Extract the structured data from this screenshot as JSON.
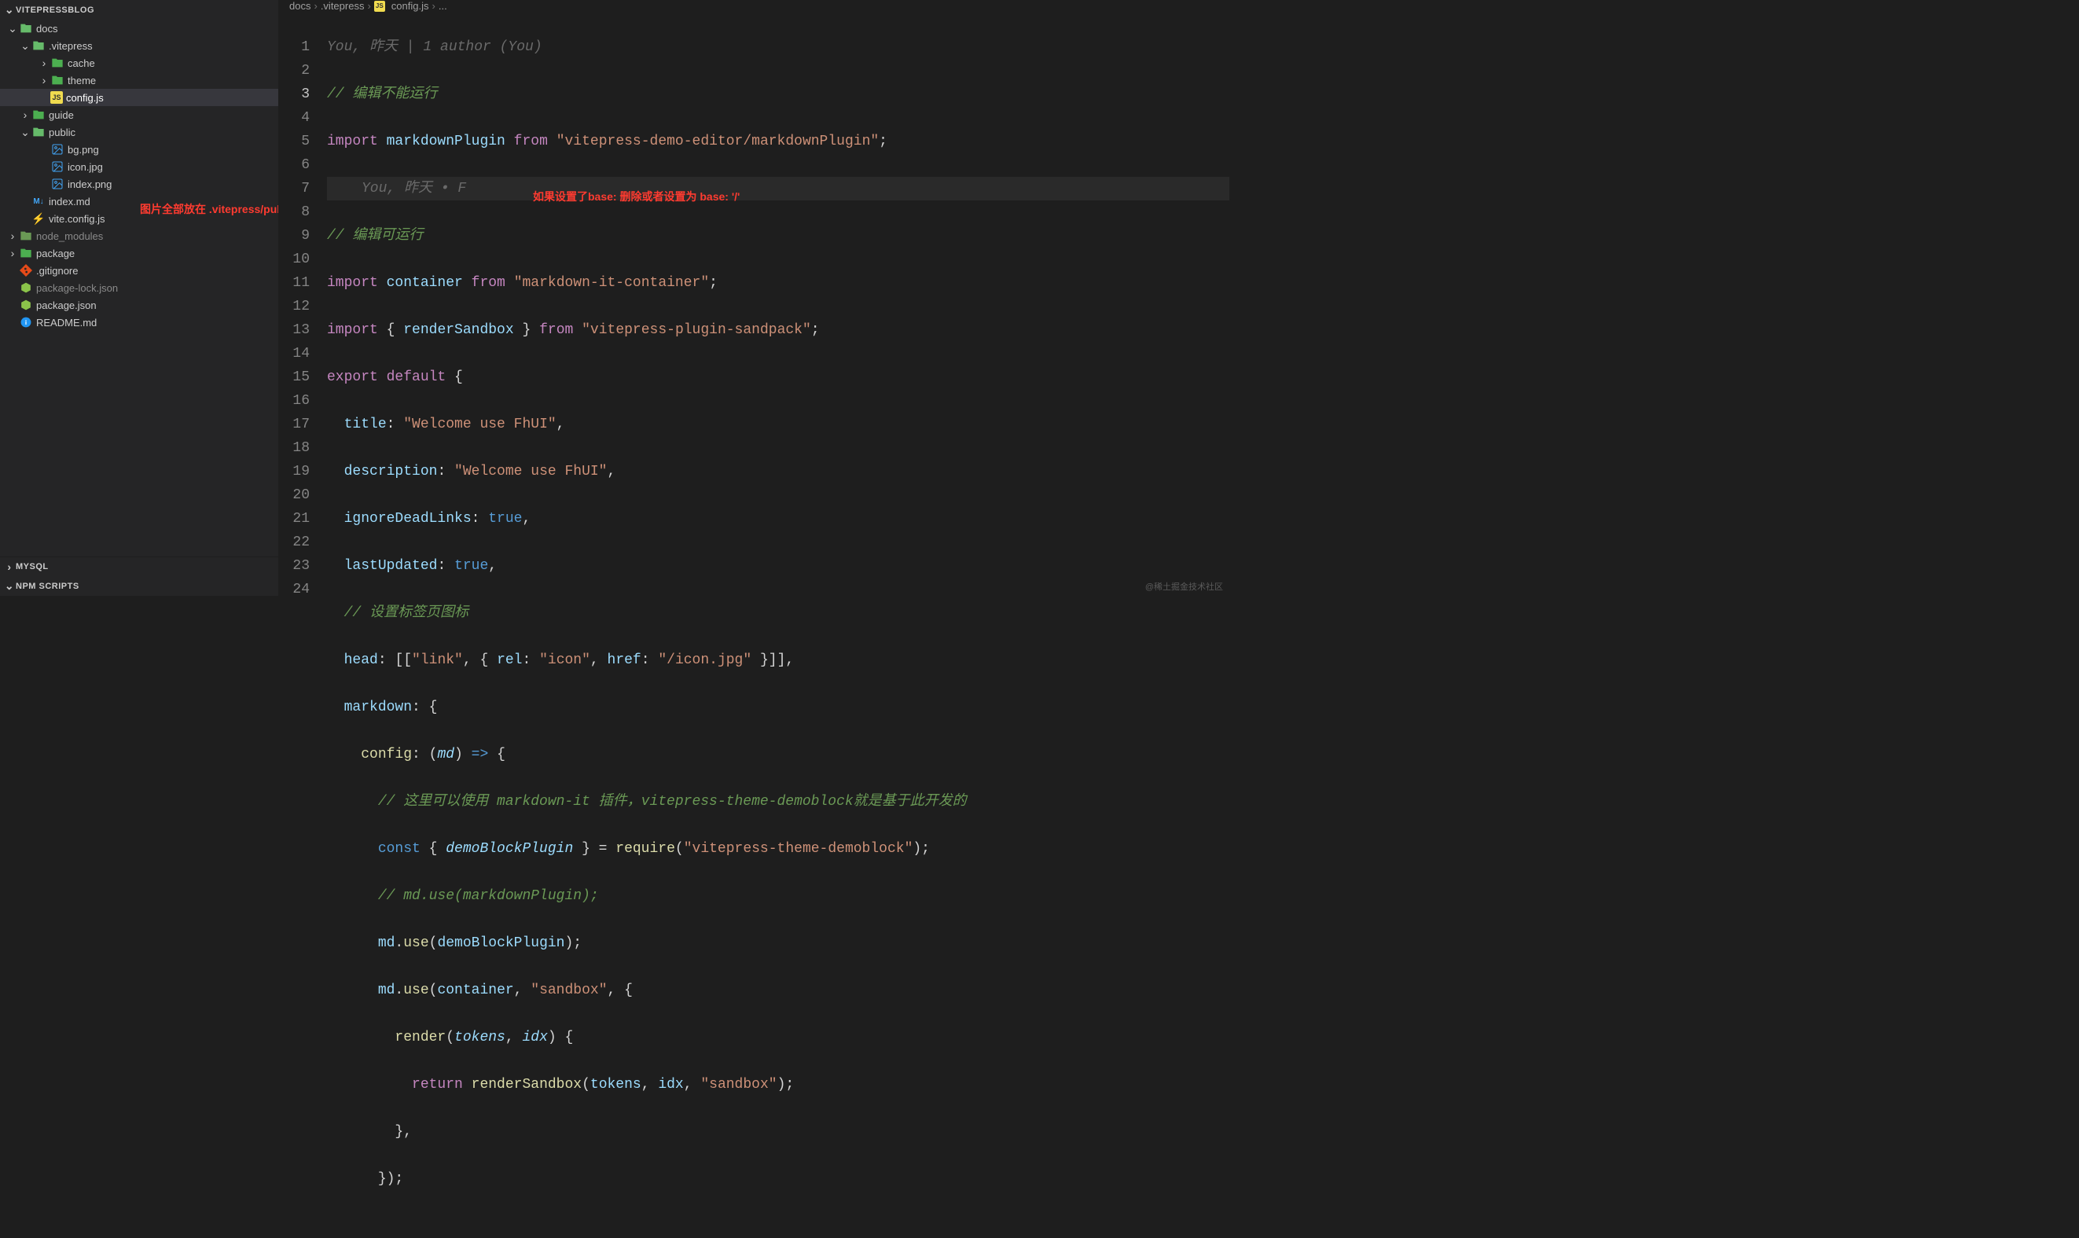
{
  "sidebar": {
    "project": "VITEPRESSBLOG",
    "tree": {
      "docs": "docs",
      "vitepress": ".vitepress",
      "cache": "cache",
      "theme": "theme",
      "configjs": "config.js",
      "guide": "guide",
      "public": "public",
      "bg": "bg.png",
      "icon": "icon.jpg",
      "indexpng": "index.png",
      "indexmd": "index.md",
      "viteconfig": "vite.config.js",
      "node_modules": "node_modules",
      "package": "package",
      "gitignore": ".gitignore",
      "pkglock": "package-lock.json",
      "pkgjson": "package.json",
      "readme": "README.md"
    },
    "panels": {
      "mysql": "MYSQL",
      "npm": "NPM SCRIPTS"
    }
  },
  "breadcrumb": {
    "p1": "docs",
    "p2": ".vitepress",
    "p3": "config.js",
    "p4": "..."
  },
  "blame": {
    "top": "You, 昨天 | 1 author (You)",
    "line3": "You, 昨天 • F"
  },
  "annotations": {
    "sidebar_note": "图片全部放在 .vitepress/public中",
    "base_note": "如果设置了base: 删除或者设置为 base: '/'"
  },
  "watermark": "@稀土掘金技术社区",
  "code": {
    "l1": {
      "c1": "// 编辑不能运行"
    },
    "l2": {
      "kw1": "import",
      "id": "markdownPlugin",
      "kw2": "from",
      "str": "\"vitepress-demo-editor/markdownPlugin\"",
      "semi": ";"
    },
    "l4": {
      "c1": "// 编辑可运行"
    },
    "l5": {
      "kw1": "import",
      "id": "container",
      "kw2": "from",
      "str": "\"markdown-it-container\"",
      "semi": ";"
    },
    "l6": {
      "kw1": "import",
      "lb": "{ ",
      "id": "renderSandbox",
      "rb": " }",
      "kw2": "from",
      "str": "\"vitepress-plugin-sandpack\"",
      "semi": ";"
    },
    "l7": {
      "kw1": "export",
      "kw2": "default",
      "lb": " {"
    },
    "l8": {
      "key": "title",
      "col": ": ",
      "str": "\"Welcome use FhUI\"",
      "c": ","
    },
    "l9": {
      "key": "description",
      "col": ": ",
      "str": "\"Welcome use FhUI\"",
      "c": ","
    },
    "l10": {
      "key": "ignoreDeadLinks",
      "col": ": ",
      "val": "true",
      "c": ","
    },
    "l11": {
      "key": "lastUpdated",
      "col": ": ",
      "val": "true",
      "c": ","
    },
    "l12": {
      "c1": "// 设置标签页图标"
    },
    "l13": {
      "key": "head",
      "col": ": ",
      "o1": "[[",
      "str1": "\"link\"",
      "c1": ", { ",
      "k1": "rel",
      "c2": ": ",
      "str2": "\"icon\"",
      "c3": ", ",
      "k2": "href",
      "c4": ": ",
      "str3": "\"/icon.jpg\"",
      "cl": " }]],"
    },
    "l14": {
      "key": "markdown",
      "col": ": {"
    },
    "l15": {
      "key": "config",
      "col": ": (",
      "prm": "md",
      "ar": ") ",
      "arrow": "=>",
      "lb": " {"
    },
    "l16": {
      "c1": "// 这里可以使用 markdown-it 插件，vitepress-theme-demoblock就是基于此开发的"
    },
    "l17": {
      "kw": "const",
      "lb": " { ",
      "id": "demoBlockPlugin",
      "rb": " } = ",
      "fn": "require",
      "lp": "(",
      "str": "\"vitepress-theme-demoblock\"",
      "rp": ");"
    },
    "l18": {
      "c1": "// md.use(markdownPlugin);"
    },
    "l19": {
      "obj": "md",
      "dot": ".",
      "fn": "use",
      "lp": "(",
      "arg": "demoBlockPlugin",
      "rp": ");"
    },
    "l20": {
      "obj": "md",
      "dot": ".",
      "fn": "use",
      "lp": "(",
      "arg": "container",
      "c": ", ",
      "str": "\"sandbox\"",
      "c2": ", {"
    },
    "l21": {
      "fn": "render",
      "lp": "(",
      "p1": "tokens",
      "c": ", ",
      "p2": "idx",
      "rp": ") {"
    },
    "l22": {
      "kw": "return",
      "sp": " ",
      "fn": "renderSandbox",
      "lp": "(",
      "a1": "tokens",
      "c1": ", ",
      "a2": "idx",
      "c2": ", ",
      "str": "\"sandbox\"",
      "rp": ");"
    },
    "l23": {
      "t": "},"
    },
    "l24": {
      "t": "});"
    }
  }
}
